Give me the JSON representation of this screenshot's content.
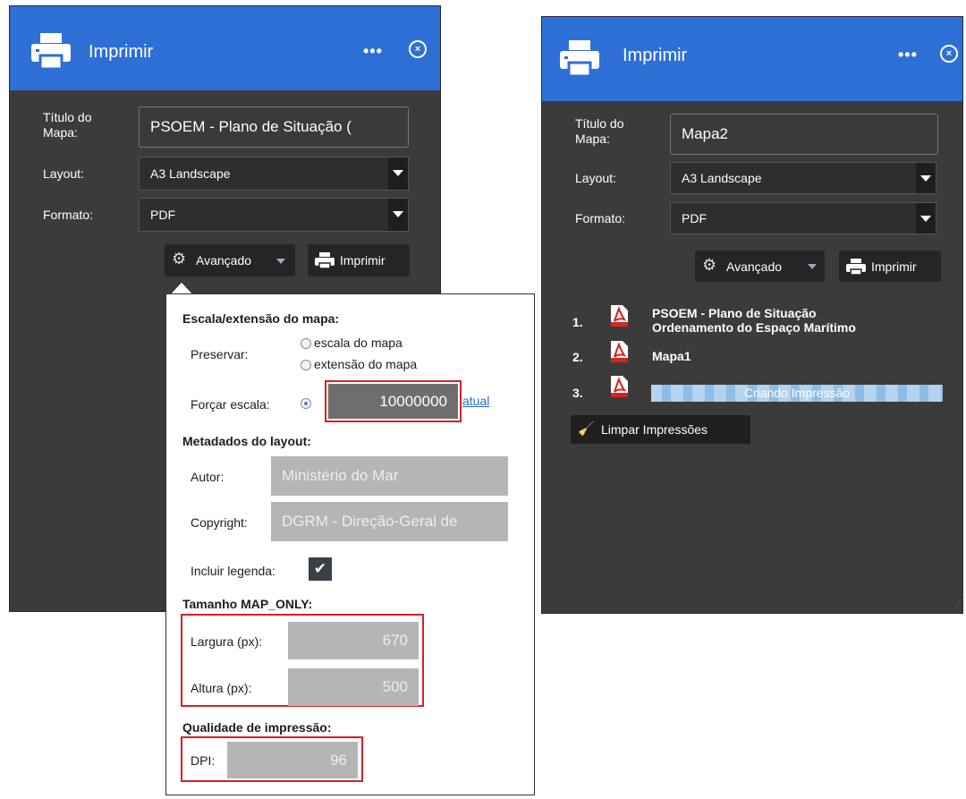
{
  "left_panel": {
    "title": "Imprimir",
    "menu": "•••",
    "close": "×",
    "title_label": "Título do\nMapa:",
    "title_value": "PSOEM - Plano de Situação (",
    "layout_label": "Layout:",
    "layout_value": "A3 Landscape",
    "format_label": "Formato:",
    "format_value": "PDF",
    "advanced_label": "Avançado",
    "print_label": "Imprimir"
  },
  "advanced": {
    "section_scale": "Escala/extensão do mapa:",
    "preserve_label": "Preservar:",
    "opt_scale": "escala do mapa",
    "opt_extent": "extensão do mapa",
    "force_scale_label": "Forçar escala:",
    "force_scale_value": "10000000",
    "current_link": "atual",
    "section_meta": "Metadados do layout:",
    "author_label": "Autor:",
    "author_value": "Ministério do Mar",
    "copyright_label": "Copyright:",
    "copyright_value": "DGRM - Direção-Geral de",
    "legend_label": "Incluir legenda:",
    "legend_checked": true,
    "section_size": "Tamanho MAP_ONLY:",
    "width_label": "Largura (px):",
    "width_value": "670",
    "height_label": "Altura (px):",
    "height_value": "500",
    "section_quality": "Qualidade de impressão:",
    "dpi_label": "DPI:",
    "dpi_value": "96"
  },
  "right_panel": {
    "title": "Imprimir",
    "menu": "•••",
    "close": "×",
    "title_label": "Título do\nMapa:",
    "title_value": "Mapa2",
    "layout_label": "Layout:",
    "layout_value": "A3 Landscape",
    "format_label": "Formato:",
    "format_value": "PDF",
    "advanced_label": "Avançado",
    "print_label": "Imprimir",
    "results": [
      {
        "num": "1.",
        "text": "PSOEM - Plano de Situação\nOrdenamento do Espaço Marítimo"
      },
      {
        "num": "2.",
        "text": "Mapa1"
      },
      {
        "num": "3.",
        "text": "Criando Impressão"
      }
    ],
    "progress_fraction": 1.0,
    "clear_label": "Limpar Impressões"
  },
  "colors": {
    "header_blue": "#2e6fd6",
    "panel_bg": "#3b3b3b",
    "highlight_red": "#d62027",
    "pdf_red": "#d4261f"
  }
}
